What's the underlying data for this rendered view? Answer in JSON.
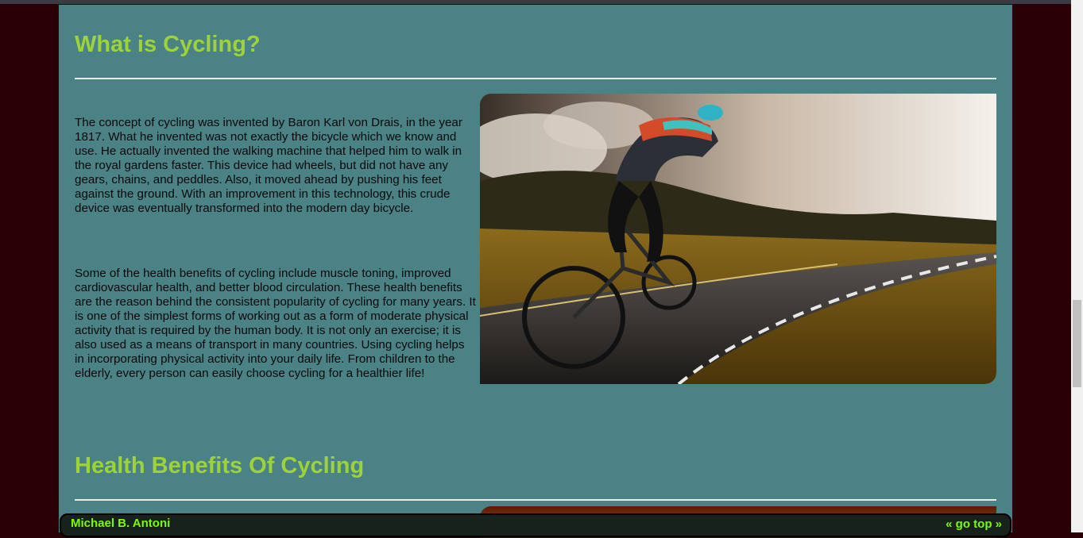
{
  "section1": {
    "title": "What is Cycling?",
    "paragraph1": "The concept of cycling was invented by Baron Karl von Drais, in the year 1817. What he invented was not exactly the bicycle which we know and use. He actually invented the walking machine that helped him to walk in the royal gardens faster. This device had wheels, but did not have any gears, chains, and peddles. Also, it moved ahead by pushing his feet against the ground. With an improvement in this technology, this crude device was eventually transformed into the modern day bicycle.",
    "paragraph2": "Some of the health benefits of cycling include muscle toning, improved cardiovascular health, and better blood circulation. These health benefits are the reason behind the consistent popularity of cycling for many years. It is one of the simplest forms of working out as a form of moderate physical activity that is required by the human body. It is not only an exercise; it is also used as a means of transport in many countries. Using cycling helps in incorporating physical activity into your daily life. From children to the elderly, every person can easily choose cycling for a healthier life!"
  },
  "section2": {
    "title": "Health Benefits Of Cycling"
  },
  "footer": {
    "author": "Michael B. Antoni",
    "go_top": "« go top »"
  },
  "colors": {
    "page_bg": "#2a0006",
    "content_bg": "#4a8285",
    "heading": "#9dd23b",
    "footer_text": "#7cfc00",
    "footer_bg": "#18221c"
  }
}
